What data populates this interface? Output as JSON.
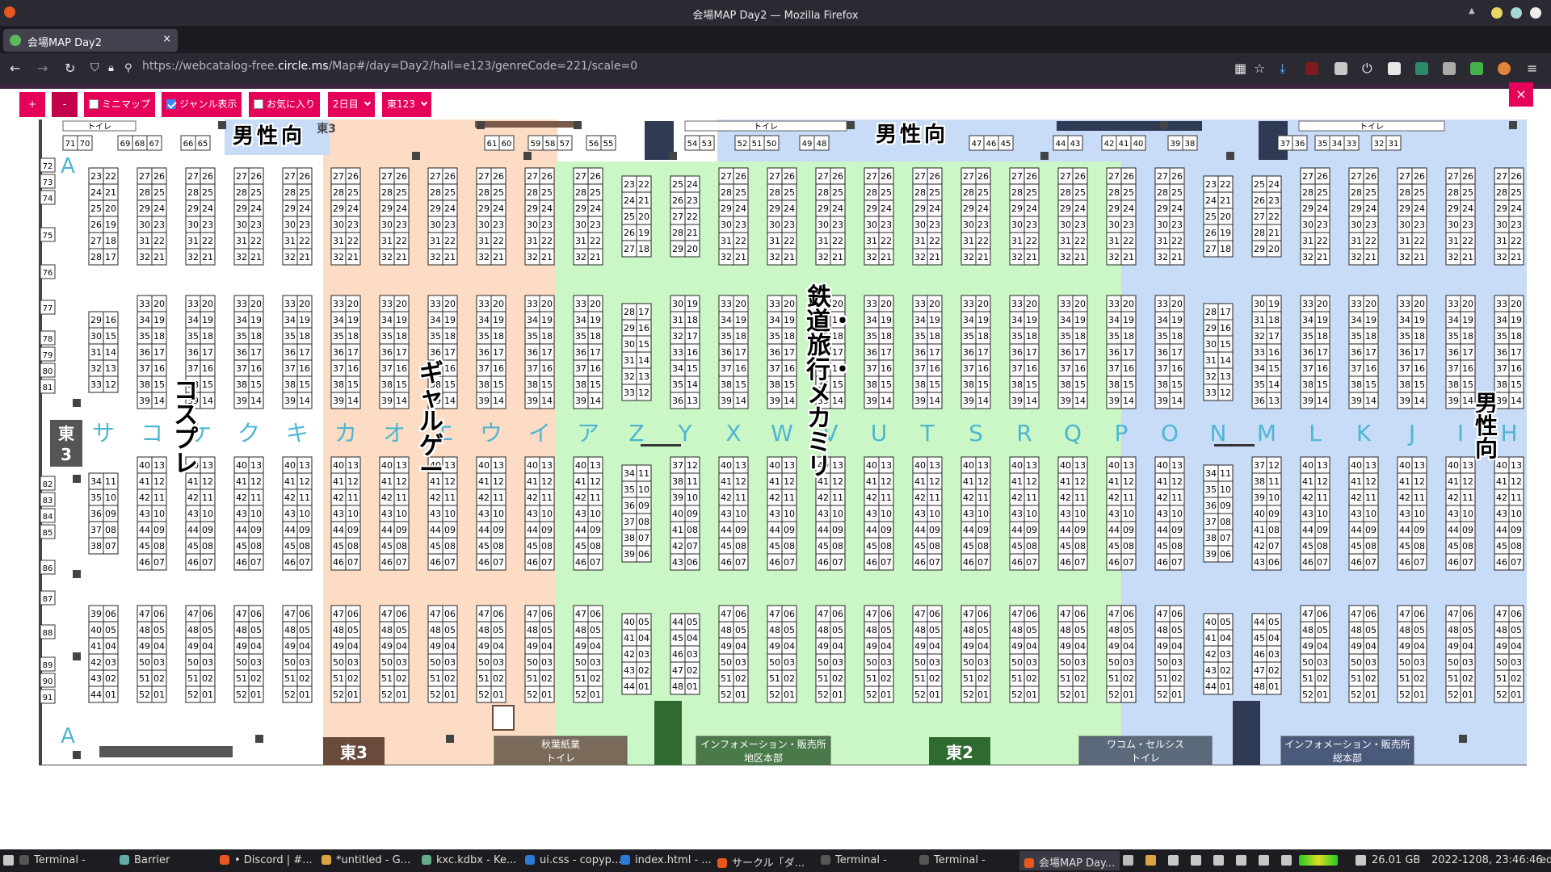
{
  "window": {
    "title": "会場MAP Day2 — Mozilla Firefox"
  },
  "tab": {
    "title": "会場MAP Day2",
    "close": "×",
    "new": "+"
  },
  "nav": {
    "url_host_prefix": "https://webcatalog-free.",
    "url_host_main": "circle.ms",
    "url_path": "/Map#/day=Day2/hall=e123/genreCode=221/scale=0"
  },
  "toolbar": {
    "zoom_in": "+",
    "zoom_out": "-",
    "minimap": "ミニマップ",
    "genre": "ジャンル表示",
    "favorite": "お気に入り",
    "day": "2日目",
    "hall": "東123",
    "close": "×"
  },
  "map": {
    "toilet": "トイレ",
    "hall_labels": {
      "e3_top": "東3",
      "e3_bottom": "東3",
      "e2_bottom": "東2",
      "e3_side": "東\n3"
    },
    "bottom_facilities": {
      "akiba": "秋葉紙業",
      "akiba_toilet": "トイレ",
      "info1": "インフォメーション・販売所",
      "hq1": "地区本部",
      "wacom": "ワコム・セルシス",
      "wacom_toilet": "トイレ",
      "info2": "インフォメーション・販売所",
      "hq2": "総本部"
    },
    "genres": {
      "g1": "男性向",
      "g2": "男性向",
      "g3": "コスプレ",
      "g4": "ギャルゲー",
      "g5": "鉄道・旅行・メカミリ",
      "g6": "男性向"
    },
    "row_letters": [
      "サ",
      "コ",
      "ケ",
      "ク",
      "キ",
      "カ",
      "オ",
      "エ",
      "ウ",
      "イ",
      "ア",
      "Z",
      "Y",
      "X",
      "W",
      "V",
      "U",
      "T",
      "S",
      "R",
      "Q",
      "P",
      "O",
      "N",
      "M",
      "L",
      "K",
      "J",
      "I",
      "H"
    ],
    "side_labels": [
      "A",
      "A"
    ],
    "left_numbers": [
      "72",
      "73",
      "74",
      "75",
      "76",
      "77",
      "78",
      "79",
      "80",
      "81",
      "82",
      "83",
      "84",
      "85",
      "86",
      "87",
      "88",
      "89",
      "90",
      "91"
    ],
    "top_wall_numbers": [
      "71",
      "70",
      "69",
      "68",
      "67",
      "66",
      "65",
      "61",
      "60",
      "59",
      "58",
      "57",
      "56",
      "55",
      "54",
      "53",
      "52",
      "51",
      "50",
      "49",
      "48",
      "47",
      "46",
      "45",
      "44",
      "43",
      "42",
      "41",
      "40",
      "39",
      "38",
      "37",
      "36",
      "35",
      "34",
      "33",
      "32",
      "31"
    ],
    "block_rows": [
      [
        [
          "27",
          "26"
        ],
        [
          "28",
          "25"
        ],
        [
          "29",
          "24"
        ],
        [
          "30",
          "23"
        ],
        [
          "31",
          "22"
        ],
        [
          "32",
          "21"
        ]
      ],
      [
        [
          "33",
          "20"
        ],
        [
          "34",
          "19"
        ],
        [
          "35",
          "18"
        ],
        [
          "36",
          "17"
        ],
        [
          "37",
          "16"
        ],
        [
          "38",
          "15"
        ],
        [
          "39",
          "14"
        ]
      ],
      [
        [
          "40",
          "13"
        ],
        [
          "41",
          "12"
        ],
        [
          "42",
          "11"
        ],
        [
          "43",
          "10"
        ],
        [
          "44",
          "09"
        ],
        [
          "45",
          "08"
        ],
        [
          "46",
          "07"
        ]
      ],
      [
        [
          "47",
          "06"
        ],
        [
          "48",
          "05"
        ],
        [
          "49",
          "04"
        ],
        [
          "50",
          "03"
        ],
        [
          "51",
          "02"
        ],
        [
          "52",
          "01"
        ]
      ]
    ],
    "special_cols": {
      "c0_r0": [
        [
          "23",
          "22"
        ],
        [
          "24",
          "21"
        ],
        [
          "25",
          "20"
        ],
        [
          "26",
          "19"
        ],
        [
          "27",
          "18"
        ],
        [
          "28",
          "17"
        ]
      ],
      "c0_r1": [
        [
          "29",
          "16"
        ],
        [
          "30",
          "15"
        ],
        [
          "31",
          "14"
        ],
        [
          "32",
          "13"
        ],
        [
          "33",
          "12"
        ]
      ],
      "c0_r2": [
        [
          "34",
          "11"
        ],
        [
          "35",
          "10"
        ],
        [
          "36",
          "09"
        ],
        [
          "37",
          "08"
        ],
        [
          "38",
          "07"
        ]
      ],
      "c0_r3": [
        [
          "39",
          "06"
        ],
        [
          "40",
          "05"
        ],
        [
          "41",
          "04"
        ],
        [
          "42",
          "03"
        ],
        [
          "43",
          "02"
        ],
        [
          "44",
          "01"
        ]
      ],
      "z_r0": [
        [
          "23",
          "22"
        ],
        [
          "24",
          "21"
        ],
        [
          "25",
          "20"
        ],
        [
          "26",
          "19"
        ],
        [
          "27",
          "18"
        ]
      ],
      "z_r1": [
        [
          "28",
          "17"
        ],
        [
          "29",
          "16"
        ],
        [
          "30",
          "15"
        ],
        [
          "31",
          "14"
        ],
        [
          "32",
          "13"
        ],
        [
          "33",
          "12"
        ]
      ],
      "z_r2": [
        [
          "34",
          "11"
        ],
        [
          "35",
          "10"
        ],
        [
          "36",
          "09"
        ],
        [
          "37",
          "08"
        ],
        [
          "38",
          "07"
        ],
        [
          "39",
          "06"
        ]
      ],
      "z_r3": [
        [
          "40",
          "05"
        ],
        [
          "41",
          "04"
        ],
        [
          "42",
          "03"
        ],
        [
          "43",
          "02"
        ],
        [
          "44",
          "01"
        ]
      ],
      "y_r0": [
        [
          "25",
          "24"
        ],
        [
          "26",
          "23"
        ],
        [
          "27",
          "22"
        ],
        [
          "28",
          "21"
        ],
        [
          "29",
          "20"
        ]
      ],
      "y_r1": [
        [
          "30",
          "19"
        ],
        [
          "31",
          "18"
        ],
        [
          "32",
          "17"
        ],
        [
          "33",
          "16"
        ],
        [
          "34",
          "15"
        ],
        [
          "35",
          "14"
        ],
        [
          "36",
          "13"
        ]
      ],
      "y_r2": [
        [
          "37",
          "12"
        ],
        [
          "38",
          "11"
        ],
        [
          "39",
          "10"
        ],
        [
          "40",
          "09"
        ],
        [
          "41",
          "08"
        ],
        [
          "42",
          "07"
        ],
        [
          "43",
          "06"
        ]
      ],
      "y_r3": [
        [
          "44",
          "05"
        ],
        [
          "45",
          "04"
        ],
        [
          "46",
          "03"
        ],
        [
          "47",
          "02"
        ],
        [
          "48",
          "01"
        ]
      ]
    }
  },
  "taskbar": {
    "items": [
      "Terminal -",
      "Barrier",
      "• Discord | #...",
      "*untitled - G...",
      "kxc.kdbx - Ke...",
      "ui.css - copyp...",
      "index.html - ...",
      "サークル「ダ...",
      "Terminal -",
      "Terminal -",
      "会場MAP Day..."
    ],
    "memory": "26.01 GB",
    "clock": "2022-1208, 23:46:46",
    "tail": "ed"
  },
  "colors": {
    "accent": "#e5005a",
    "orange": "#fcdcc4",
    "green": "#caf7c5",
    "blue": "#c8dcf8"
  }
}
